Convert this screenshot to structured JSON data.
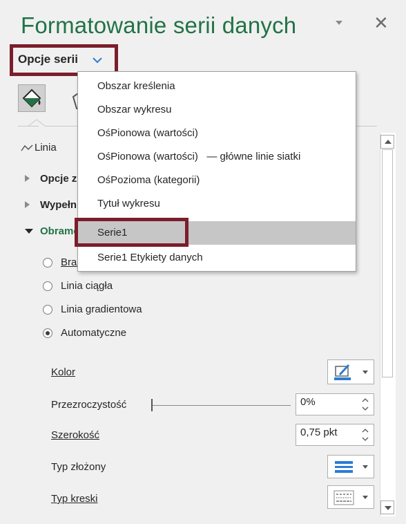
{
  "pane": {
    "title": "Formatowanie serii danych",
    "series_options_label": "Opcje serii"
  },
  "dropdown_menu": {
    "items": [
      "Obszar kreślenia",
      "Obszar wykresu",
      "OśPionowa (wartości)",
      "OśPionowa (wartości)   — główne linie siatki",
      "OśPozioma (kategorii)",
      "Tytuł wykresu",
      "Serie1",
      "Serie1 Etykiety danych"
    ],
    "selected": "Serie1"
  },
  "sections": {
    "line": "Linia",
    "options_partial": "Opcje zr",
    "fill_partial": "Wypełni",
    "border_partial": "Obramo"
  },
  "radios": [
    {
      "label": "Brak",
      "checked": false
    },
    {
      "label": "Linia ciągła",
      "checked": false
    },
    {
      "label": "Linia gradientowa",
      "checked": false
    },
    {
      "label": "Automatyczne",
      "checked": true
    }
  ],
  "properties": {
    "color_label": "Kolor",
    "transparency_label": "Przezroczystość",
    "transparency_value": "0%",
    "width_label": "Szerokość",
    "width_value": "0,75 pkt",
    "compound_label": "Typ złożony",
    "dash_label": "Typ kreski"
  },
  "colors": {
    "title_green": "#217346",
    "highlight_red": "#7b1e2b",
    "menu_selected": "#c6c6c6",
    "accent_blue": "#2b7cd3"
  }
}
